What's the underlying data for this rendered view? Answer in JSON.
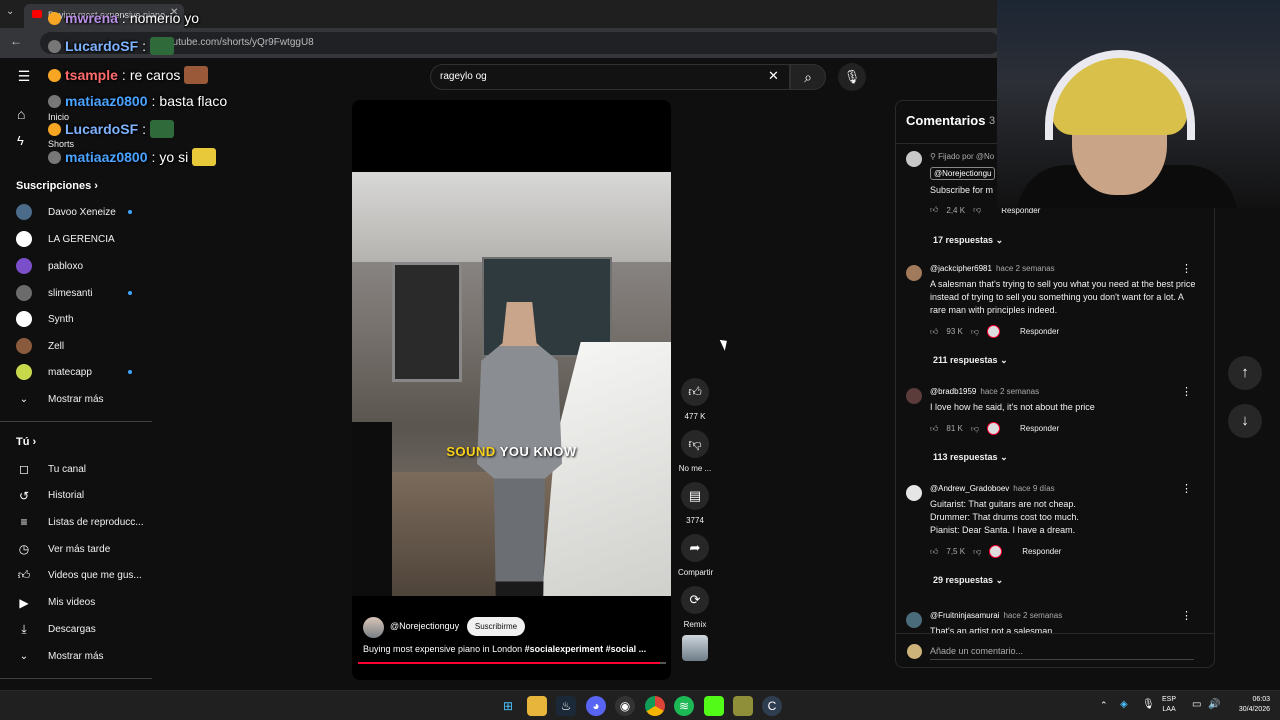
{
  "browser": {
    "tab_title": "Buying most expensive piano",
    "url": "youtube.com/shorts/yQr9FwtggU8"
  },
  "search": {
    "query": "rageylo og"
  },
  "sidebar": {
    "home_label": "Inicio",
    "shorts_label": "Shorts",
    "subscriptions_title": "Suscripciones",
    "subscriptions": [
      {
        "name": "Davoo Xeneize",
        "color": "#4a6b8a",
        "new": true
      },
      {
        "name": "LA GERENCIA",
        "color": "#ffffff",
        "new": false
      },
      {
        "name": "pabloxo",
        "color": "#7b4fc9",
        "new": false
      },
      {
        "name": "slimesanti",
        "color": "#6b6b6b",
        "new": true
      },
      {
        "name": "Synth",
        "color": "#ffffff",
        "new": false
      },
      {
        "name": "Zell",
        "color": "#8a5a3c",
        "new": false
      },
      {
        "name": "matecapp",
        "color": "#c7d94a",
        "new": true
      }
    ],
    "show_more_subs": "Mostrar más",
    "you_title": "Tú",
    "you_items": [
      {
        "label": "Tu canal",
        "icon": "channel-icon"
      },
      {
        "label": "Historial",
        "icon": "history-icon"
      },
      {
        "label": "Listas de reproducc...",
        "icon": "playlists-icon"
      },
      {
        "label": "Ver más tarde",
        "icon": "watch-later-icon"
      },
      {
        "label": "Videos que me gus...",
        "icon": "liked-icon"
      },
      {
        "label": "Mis videos",
        "icon": "my-videos-icon"
      },
      {
        "label": "Descargas",
        "icon": "downloads-icon"
      }
    ],
    "show_more_you": "Mostrar más"
  },
  "short": {
    "caption_highlight": "SOUND",
    "caption_rest": " YOU KNOW",
    "channel": "@Norejectionguy",
    "subscribe_label": "Suscribirme",
    "title_plain": "Buying most expensive piano in London ",
    "title_tags": "#socialexperiment #social ...",
    "progress": 0.98,
    "actions": {
      "likes": "477 K",
      "dislike_label": "No me ...",
      "comments": "3774",
      "share_label": "Compartir",
      "remix_label": "Remix"
    }
  },
  "comments": {
    "title": "Comentarios",
    "count": "3",
    "pinned": {
      "pinned_by": "Fijado por @No",
      "mention": "@Norejectiongu",
      "text": "Subscribe for m",
      "likes": "2,4 K",
      "reply_label": "Responder",
      "replies": "17 respuestas"
    },
    "items": [
      {
        "author": "@jackcipher6981",
        "time": "hace 2 semanas",
        "text": "A salesman that's trying to sell you what you need at the best price instead of trying to sell you something you don't want for a lot. A rare man with principles indeed.",
        "likes": "93 K",
        "reply_label": "Responder",
        "replies": "211 respuestas",
        "color": "#a07a5a"
      },
      {
        "author": "@bradb1959",
        "time": "hace 2 semanas",
        "text": "I love how he said, it's not about the price",
        "likes": "81 K",
        "reply_label": "Responder",
        "replies": "113 respuestas",
        "color": "#5c3b3b"
      },
      {
        "author": "@Andrew_Gradoboev",
        "time": "hace 9 días",
        "text": "Guitarist: That guitars are not cheap.\nDrummer: That drums cost too much.\nPianist: Dear Santa. I have a dream.",
        "likes": "7,5 K",
        "reply_label": "Responder",
        "replies": "29 respuestas",
        "color": "#e6e6e6"
      },
      {
        "author": "@Fruitninjasamurai",
        "time": "hace 2 semanas",
        "text": "That's an artist not a salesman",
        "color": "#4a6b7a"
      }
    ],
    "add_placeholder": "Añade un comentario..."
  },
  "chat": [
    {
      "user": "mwrena",
      "message": "nomerio yo",
      "color": "#b98fe6"
    },
    {
      "user": "LucardoSF",
      "message": "",
      "color": "#7fb3ff"
    },
    {
      "user": "tsample",
      "message": "re caros",
      "color": "#ff6b6b"
    },
    {
      "user": "matiaaz0800",
      "message": "basta flaco",
      "color": "#4aa3ff"
    },
    {
      "user": "LucardoSF",
      "message": "",
      "color": "#7fb3ff"
    },
    {
      "user": "matiaaz0800",
      "message": "yo si",
      "color": "#4aa3ff"
    }
  ],
  "taskbar": {
    "lang_top": "ESP",
    "lang_bottom": "LAA",
    "time": "06:03",
    "date": "30/4/2026"
  },
  "colors": {
    "accent": "#ff0033",
    "link": "#3ea6ff",
    "bg": "#0f0f0f"
  }
}
